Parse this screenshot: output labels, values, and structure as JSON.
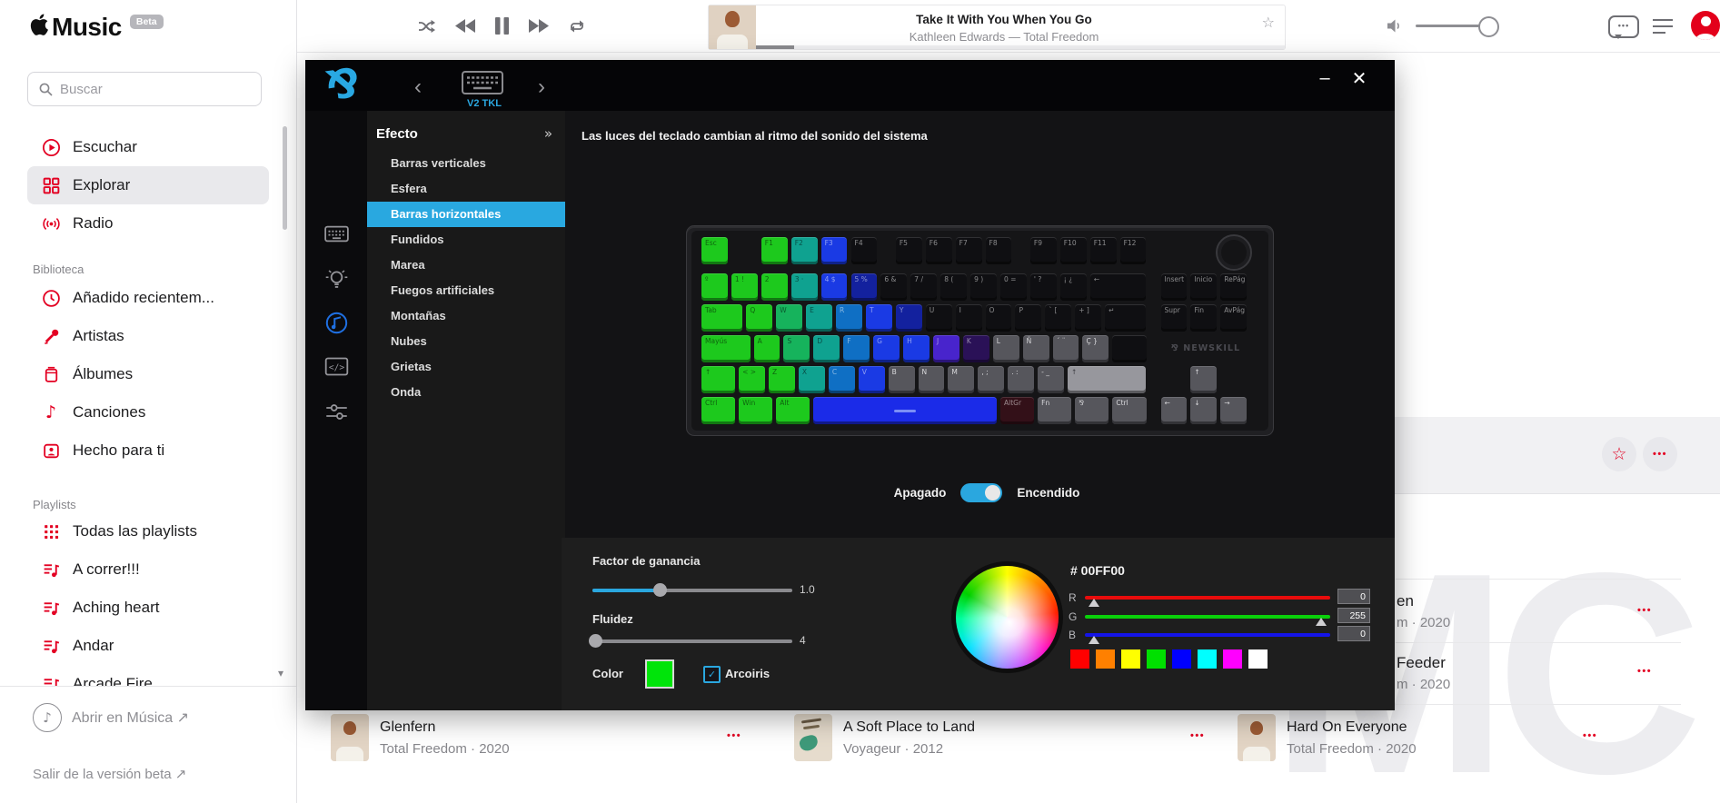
{
  "app": {
    "brand": "Music",
    "beta": "Beta"
  },
  "sidebar": {
    "search_placeholder": "Buscar",
    "nav": [
      {
        "label": "Escuchar",
        "icon": "play-circle-icon"
      },
      {
        "label": "Explorar",
        "icon": "grid-icon",
        "selected": true
      },
      {
        "label": "Radio",
        "icon": "radio-icon"
      }
    ],
    "library_label": "Biblioteca",
    "library": [
      {
        "label": "Añadido recientem...",
        "icon": "clock-icon"
      },
      {
        "label": "Artistas",
        "icon": "mic-icon"
      },
      {
        "label": "Álbumes",
        "icon": "album-icon"
      },
      {
        "label": "Canciones",
        "icon": "note-icon"
      },
      {
        "label": "Hecho para ti",
        "icon": "person-icon"
      }
    ],
    "playlists_label": "Playlists",
    "playlists": [
      {
        "label": "Todas las playlists",
        "icon": "grid-dots-icon"
      },
      {
        "label": "A correr!!!",
        "icon": "playlist-icon"
      },
      {
        "label": "Aching heart",
        "icon": "playlist-icon"
      },
      {
        "label": "Andar",
        "icon": "playlist-icon"
      },
      {
        "label": "Arcade Fire",
        "icon": "playlist-icon"
      }
    ],
    "open_in_music": "Abrir en Música ↗",
    "leave_beta": "Salir de la versión beta ↗"
  },
  "player": {
    "title": "Take It With You When You Go",
    "subtitle": "Kathleen Edwards — Total Freedom"
  },
  "overlay": {
    "device": "V2 TKL",
    "description": "Las luces del teclado cambian al ritmo del sonido del sistema",
    "effect_panel": {
      "title": "Efecto",
      "selected_index": 2,
      "items": [
        "Barras verticales",
        "Esfera",
        "Barras horizontales",
        "Fundidos",
        "Marea",
        "Fuegos artificiales",
        "Montañas",
        "Nubes",
        "Grietas",
        "Onda"
      ]
    },
    "toggle": {
      "off_label": "Apagado",
      "on_label": "Encendido",
      "state": "on"
    },
    "controls": {
      "gain": {
        "label": "Factor de ganancia",
        "value": "1.0"
      },
      "fluidity": {
        "label": "Fluidez",
        "value": "4"
      },
      "color_label": "Color",
      "rainbow_label": "Arcoiris",
      "rainbow_checked": true
    },
    "color_picker": {
      "hex": "# 00FF00",
      "rgb": [
        {
          "label": "R",
          "value": "0"
        },
        {
          "label": "G",
          "value": "255"
        },
        {
          "label": "B",
          "value": "0"
        }
      ],
      "swatches": [
        "#ff0000",
        "#ff8000",
        "#ffff00",
        "#00e000",
        "#0000ff",
        "#00ffff",
        "#ff00ff",
        "#ffffff"
      ]
    },
    "keyboard": {
      "brand": "NEWSKILL",
      "palette": {
        "g": "#1dc91d",
        "gt": "#16b35c",
        "t": "#0fa290",
        "tb": "#0f6fc4",
        "b": "#1a3ae4",
        "nb": "#13219e",
        "v": "#4824cc",
        "dv": "#2a1157",
        "k": "#0f0f12",
        "gr": "#56565c",
        "lg": "#97979d",
        "mr": "#331018",
        "sb": "#1b2be8"
      },
      "main_rows": [
        [
          [
            "Esc",
            1,
            "g"
          ],
          [
            "",
            1,
            "sp"
          ],
          [
            "F1",
            1,
            "g"
          ],
          [
            "F2",
            1,
            "t"
          ],
          [
            "F3",
            1,
            "b"
          ],
          [
            "F4",
            1,
            "k"
          ],
          [
            "",
            0.5,
            "sp"
          ],
          [
            "F5",
            1,
            "k"
          ],
          [
            "F6",
            1,
            "k"
          ],
          [
            "F7",
            1,
            "k"
          ],
          [
            "F8",
            1,
            "k"
          ],
          [
            "",
            0.5,
            "sp"
          ],
          [
            "F9",
            1,
            "k"
          ],
          [
            "F10",
            1,
            "k"
          ],
          [
            "F11",
            1,
            "k"
          ],
          [
            "F12",
            1,
            "k"
          ]
        ],
        [
          [
            "º",
            1,
            "g"
          ],
          [
            "1 !",
            1,
            "g"
          ],
          [
            "2",
            1,
            "g"
          ],
          [
            "3 ·",
            1,
            "t"
          ],
          [
            "4 $",
            1,
            "b"
          ],
          [
            "5 %",
            1,
            "nb"
          ],
          [
            "6 &",
            1,
            "k"
          ],
          [
            "7 /",
            1,
            "k"
          ],
          [
            "8 (",
            1,
            "k"
          ],
          [
            "9 )",
            1,
            "k"
          ],
          [
            "0 =",
            1,
            "k"
          ],
          [
            "' ?",
            1,
            "k"
          ],
          [
            "¡ ¿",
            1,
            "k"
          ],
          [
            "←",
            2,
            "k"
          ]
        ],
        [
          [
            "Tab",
            1.5,
            "g"
          ],
          [
            "Q",
            1,
            "g"
          ],
          [
            "W",
            1,
            "gt"
          ],
          [
            "E",
            1,
            "t"
          ],
          [
            "R",
            1,
            "tb"
          ],
          [
            "T",
            1,
            "b"
          ],
          [
            "Y",
            1,
            "nb"
          ],
          [
            "U",
            1,
            "k"
          ],
          [
            "I",
            1,
            "k"
          ],
          [
            "O",
            1,
            "k"
          ],
          [
            "P",
            1,
            "k"
          ],
          [
            "` [",
            1,
            "k"
          ],
          [
            "+ ]",
            1,
            "k"
          ],
          [
            "↵",
            1.5,
            "k"
          ]
        ],
        [
          [
            "Mayús",
            1.75,
            "g"
          ],
          [
            "A",
            1,
            "g"
          ],
          [
            "S",
            1,
            "gt"
          ],
          [
            "D",
            1,
            "t"
          ],
          [
            "F",
            1,
            "tb"
          ],
          [
            "G",
            1,
            "b"
          ],
          [
            "H",
            1,
            "b"
          ],
          [
            "J",
            1,
            "v"
          ],
          [
            "K",
            1,
            "dv"
          ],
          [
            "L",
            1,
            "gr"
          ],
          [
            "Ñ",
            1,
            "gr"
          ],
          [
            "´ ¨",
            1,
            "gr"
          ],
          [
            "Ç }",
            1,
            "gr"
          ],
          [
            "",
            1.25,
            "k"
          ]
        ],
        [
          [
            "↑",
            1.25,
            "g"
          ],
          [
            "< >",
            1,
            "g"
          ],
          [
            "Z",
            1,
            "g"
          ],
          [
            "X",
            1,
            "t"
          ],
          [
            "C",
            1,
            "tb"
          ],
          [
            "V",
            1,
            "b"
          ],
          [
            "B",
            1,
            "gr"
          ],
          [
            "N",
            1,
            "gr"
          ],
          [
            "M",
            1,
            "gr"
          ],
          [
            ", ;",
            1,
            "gr"
          ],
          [
            ". :",
            1,
            "gr"
          ],
          [
            "- _",
            1,
            "gr"
          ],
          [
            "↑",
            2.75,
            "lg"
          ]
        ],
        [
          [
            "Ctrl",
            1.25,
            "g"
          ],
          [
            "Win",
            1.25,
            "g"
          ],
          [
            "Alt",
            1.25,
            "g"
          ],
          [
            "",
            6.25,
            "sb"
          ],
          [
            "AltGr",
            1.25,
            "mr"
          ],
          [
            "Fn",
            1.25,
            "gr"
          ],
          [
            "⅋",
            1.25,
            "gr"
          ],
          [
            "Ctrl",
            1.25,
            "gr"
          ]
        ]
      ],
      "nav_rows": [
        [
          "Insert",
          "Inicio",
          "RePág"
        ],
        [
          "Supr",
          "Fin",
          "AvPág"
        ]
      ],
      "arrow_up": "↑",
      "arrows": [
        "←",
        "↓",
        "→"
      ]
    }
  },
  "background": {
    "partial_rows": [
      {
        "title": "en",
        "subtitle": "m · 2020"
      },
      {
        "title": "Feeder",
        "subtitle": "m · 2020"
      }
    ],
    "songs": [
      {
        "title": "Glenfern",
        "subtitle": "Total Freedom · 2020",
        "art": "portrait"
      },
      {
        "title": "A Soft Place to Land",
        "subtitle": "Voyageur · 2012",
        "art": "painting"
      },
      {
        "title": "Hard On Everyone",
        "subtitle": "Total Freedom · 2020",
        "art": "portrait"
      }
    ],
    "watermark": "MC"
  }
}
